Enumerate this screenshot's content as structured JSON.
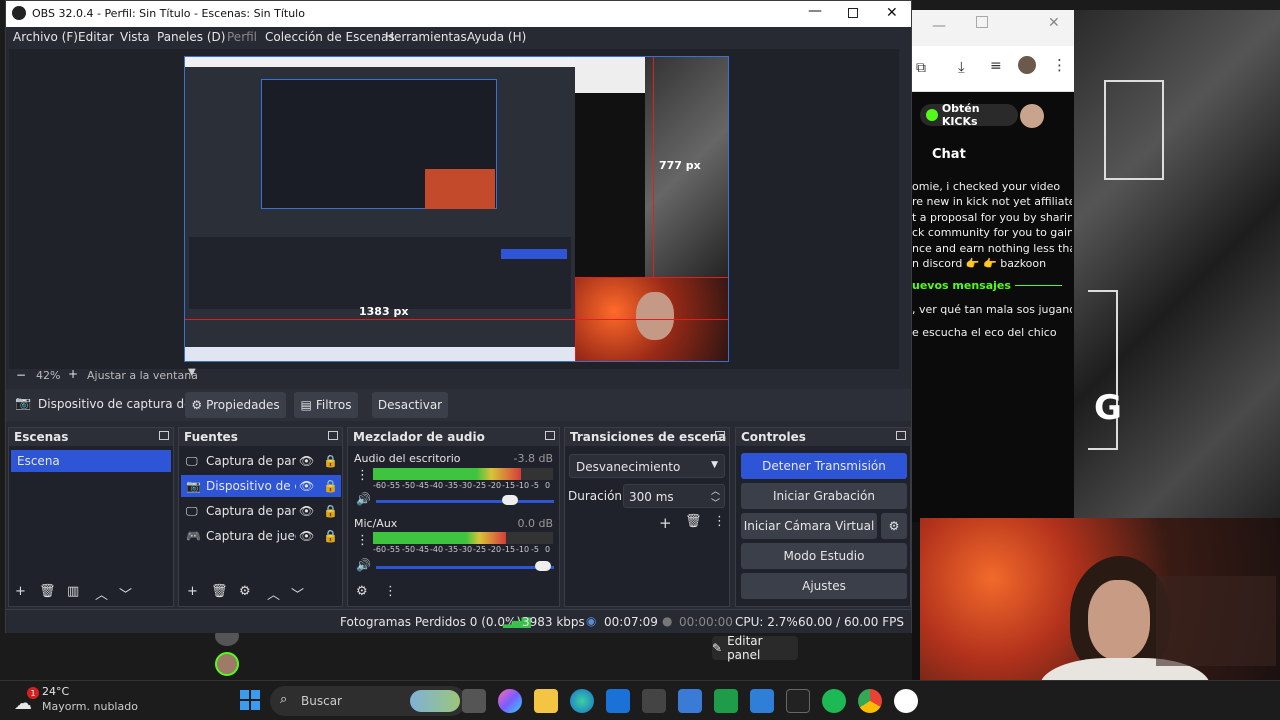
{
  "obs": {
    "window_title": "OBS 32.0.4 - Perfil: Sin Título - Escenas: Sin Título",
    "menu": [
      "Archivo (F)",
      "Editar",
      "Vista",
      "Paneles (D)",
      "Perfil",
      "Colección de Escenas",
      "Herramientas",
      "Ayuda (H)"
    ],
    "preview": {
      "dim_width": "1383 px",
      "dim_height": "777 px"
    },
    "zoom": {
      "value": "42%",
      "fit_label": "Ajustar a la ventana"
    },
    "source_toolbar": {
      "selected_source": "Dispositivo de captura de v",
      "properties_label": "Propiedades",
      "filters_label": "Filtros",
      "deactivate_label": "Desactivar"
    },
    "docks": {
      "scenes": {
        "title": "Escenas",
        "items": [
          "Escena"
        ]
      },
      "sources": {
        "title": "Fuentes",
        "items": [
          {
            "label": "Captura de panta",
            "icon": "monitor-icon"
          },
          {
            "label": "Dispositivo de cap",
            "icon": "camera-icon"
          },
          {
            "label": "Captura de panta",
            "icon": "monitor-icon"
          },
          {
            "label": "Captura de juego",
            "icon": "gamepad-icon"
          }
        ]
      },
      "mixer": {
        "title": "Mezclador de audio",
        "channels": [
          {
            "name": "Audio del escritorio",
            "db": "-3.8 dB",
            "level": 0.82,
            "volume": 0.78
          },
          {
            "name": "Mic/Aux",
            "db": "0.0 dB",
            "level": 0.74,
            "volume": 0.98
          }
        ],
        "scale": [
          "-60",
          "-55",
          "-50",
          "-45",
          "-40",
          "-35",
          "-30",
          "-25",
          "-20",
          "-15",
          "-10",
          "-5",
          "0"
        ]
      },
      "transitions": {
        "title": "Transiciones de escena",
        "selected": "Desvanecimiento",
        "duration_label": "Duración",
        "duration_value": "300 ms"
      },
      "controls": {
        "title": "Controles",
        "buttons": [
          "Detener Transmisión",
          "Iniciar Grabación",
          "Iniciar Cámara Virtual",
          "Modo Estudio",
          "Ajustes"
        ]
      }
    },
    "status": {
      "dropped_frames": "Fotogramas Perdidos 0 (0.0%)",
      "bitrate": "3983 kbps",
      "stream_time": "00:07:09",
      "record_time": "00:00:00",
      "cpu": "CPU: 2.7%",
      "fps": "60.00 / 60.00 FPS"
    }
  },
  "browser": {
    "kicks_label": "Obtén KICKs",
    "chat_title": "Chat",
    "chat_lines": [
      "omie, i checked your video",
      "re new in kick not yet affiliated",
      "t a proposal for you by sharing",
      "ck community for you to gain",
      "nce and earn nothing less than",
      "n discord 👉 👉 bazkoon"
    ],
    "new_messages": "uevos mensajes",
    "chat_lines_2": [
      ", ver qué tan mala sos jugando",
      "e escucha el eco del chico"
    ],
    "edit_panel": "Editar panel"
  },
  "taskbar": {
    "weather_temp": "24°C",
    "weather_desc": "Mayorm. nublado",
    "badge": "1",
    "search_placeholder": "Buscar"
  },
  "colors": {
    "accent_blue": "#2d55d6",
    "obs_bg": "#272a33",
    "dock_bg": "#1f222a",
    "button_bg": "#3b3f49",
    "kick_green": "#53fc18"
  }
}
